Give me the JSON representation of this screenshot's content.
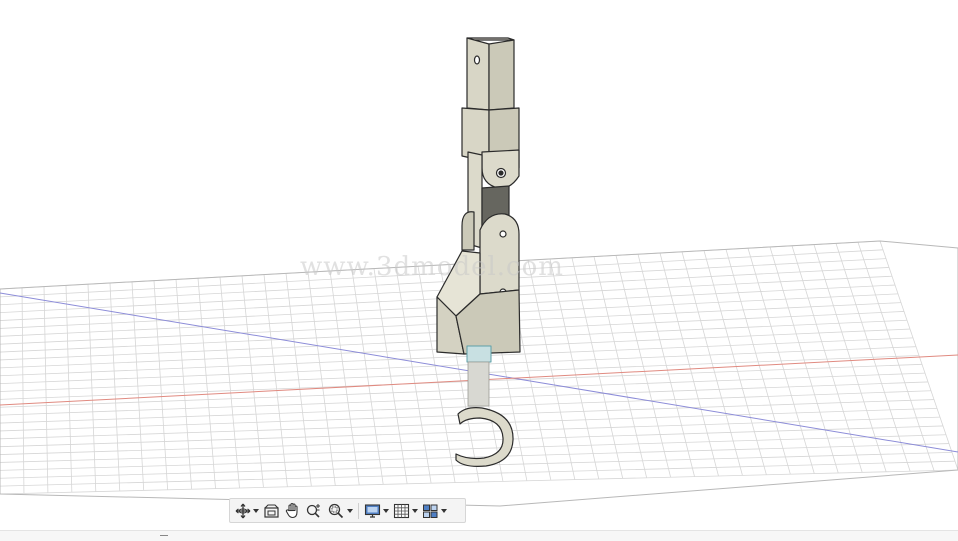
{
  "viewport": {
    "watermark": "www.3dmodel.com",
    "colors": {
      "background": "#ffffff",
      "grid_line": "#d4d4d4",
      "x_axis": "#e08a80",
      "y_axis": "#8c8cd8",
      "model_fill": "#dcdacb",
      "model_shade": "#c4c2b3",
      "model_dark": "#66665f",
      "model_edge": "#2b2b2b",
      "highlight": "#5ea0a8"
    }
  },
  "toolbar": {
    "buttons": [
      {
        "icon": "orbit-icon",
        "dropdown": true
      },
      {
        "icon": "look-at-icon",
        "dropdown": false
      },
      {
        "icon": "pan-hand-icon",
        "dropdown": false
      },
      {
        "icon": "zoom-icon",
        "dropdown": false
      },
      {
        "icon": "fit-zoom-icon",
        "dropdown": true
      },
      {
        "icon": "display-settings-icon",
        "dropdown": true
      },
      {
        "icon": "grid-settings-icon",
        "dropdown": true
      },
      {
        "icon": "viewports-icon",
        "dropdown": true
      }
    ]
  }
}
